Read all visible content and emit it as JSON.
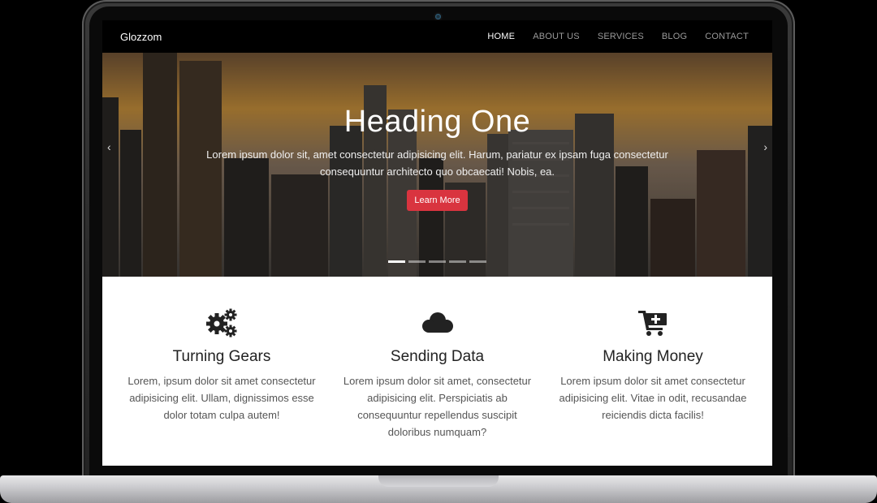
{
  "navbar": {
    "brand": "Glozzom",
    "links": [
      {
        "label": "HOME",
        "active": true
      },
      {
        "label": "ABOUT US"
      },
      {
        "label": "SERVICES"
      },
      {
        "label": "BLOG"
      },
      {
        "label": "CONTACT"
      }
    ]
  },
  "hero": {
    "title": "Heading One",
    "text": "Lorem ipsum dolor sit, amet consectetur adipisicing elit. Harum, pariatur ex ipsam fuga consectetur consequuntur architecto quo obcaecati! Nobis, ea.",
    "button_label": "Learn More",
    "prev_arrow": "‹",
    "next_arrow": "›",
    "slide_count": 5,
    "active_slide": 1
  },
  "features": [
    {
      "icon": "gears-icon",
      "title": "Turning Gears",
      "text": "Lorem, ipsum dolor sit amet consectetur adipisicing elit. Ullam, dignissimos esse dolor totam culpa autem!"
    },
    {
      "icon": "cloud-icon",
      "title": "Sending Data",
      "text": "Lorem ipsum dolor sit amet, consectetur adipisicing elit. Perspiciatis ab consequuntur repellendus suscipit doloribus numquam?"
    },
    {
      "icon": "cart-plus-icon",
      "title": "Making Money",
      "text": "Lorem ipsum dolor sit amet consectetur adipisicing elit. Vitae in odit, recusandae reiciendis dicta facilis!"
    }
  ],
  "colors": {
    "accent": "#d9343f",
    "navbar_bg": "#000000"
  }
}
